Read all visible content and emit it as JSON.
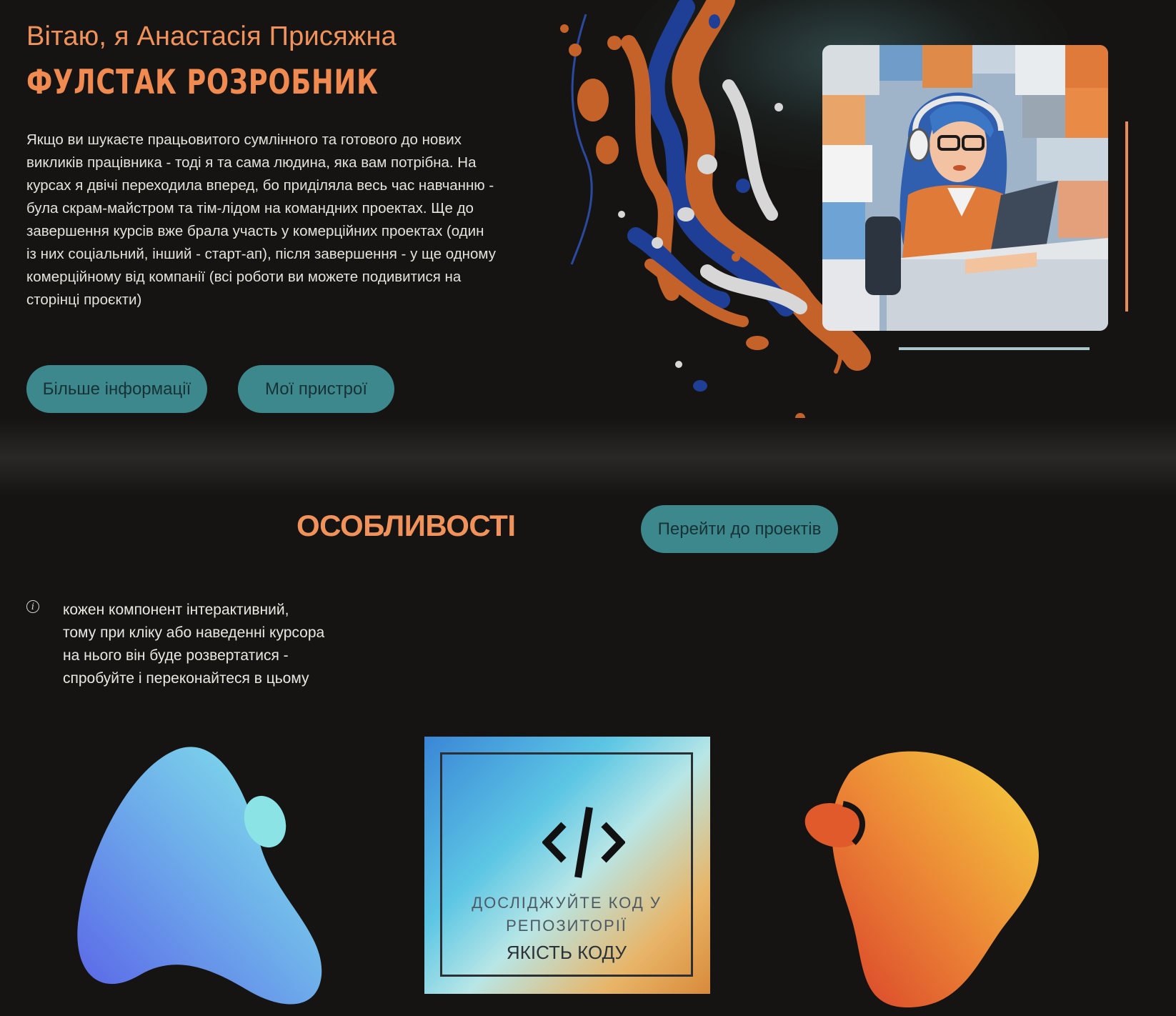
{
  "hero": {
    "greeting": "Вітаю, я Анастасія Присяжна",
    "role": "ФУЛСТАК РОЗРОБНИК",
    "description": "Якщо ви шукаєте працьовитого сумлінного та готового до нових викликів працівника - тоді я та сама людина, яка вам потрібна. На курсах я двічі переходила вперед, бо приділяла весь час навчанню - була скрам-майстром та тім-лідом на командних проектах. Ще до завершення курсів вже брала участь у комерційних проектах (один із них соціальний, інший - старт-ап), після завершення - у ще одному комерційному від компанії (всі роботи ви можете подивитися на сторінці проєкти)",
    "buttons": {
      "more_info": "Більше інформації",
      "my_devices": "Мої пристрої"
    }
  },
  "features": {
    "title": "ОСОБЛИВОСТІ",
    "projects_button": "Перейти до проектів",
    "info_icon": "info-icon",
    "info_lines": [
      "кожен компонент інтерактивний,",
      "тому при кліку або наведенні курсора",
      "на нього він буде розвертатися -",
      "спробуйте і переконайтеся в цьому"
    ]
  },
  "cards": {
    "code_card": {
      "icon": "code-icon",
      "subtitle_lines": [
        "ДОСЛІДЖУЙТЕ КОД У",
        "РЕПОЗИТОРІЇ"
      ],
      "title": "ЯКІСТЬ КОДУ"
    }
  },
  "colors": {
    "background": "#151412",
    "accent_orange": "#f0925a",
    "button_teal": "#3d888c",
    "text_light": "#e6e2dc"
  }
}
